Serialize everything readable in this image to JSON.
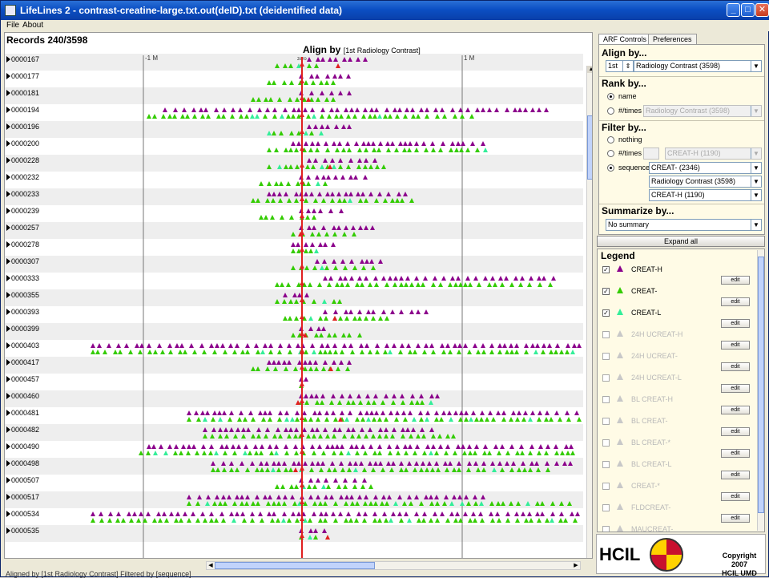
{
  "window": {
    "title": "LifeLines 2 - contrast-creatine-large.txt.out(deID).txt (deidentified data)",
    "buttons": {
      "minimize": "_",
      "maximize": "□",
      "close": "✕"
    }
  },
  "menu": {
    "file": "File",
    "about": "About"
  },
  "viz": {
    "records": "Records 240/3598",
    "align_title": "Align by",
    "align_detail": "[1st Radiology Contrast]",
    "axis_left_label": "-1 M",
    "axis_right_label": "1 M",
    "axis_zero_label": "zero",
    "row_ids": [
      "0000167",
      "0000177",
      "0000181",
      "0000194",
      "0000196",
      "0000200",
      "0000228",
      "0000232",
      "0000233",
      "0000239",
      "0000257",
      "0000278",
      "0000307",
      "0000333",
      "0000355",
      "0000393",
      "0000399",
      "0000403",
      "0000417",
      "0000457",
      "0000460",
      "0000481",
      "0000482",
      "0000490",
      "0000498",
      "0000507",
      "0000517",
      "0000534",
      "0000535"
    ]
  },
  "status": "Aligned by [1st Radiology Contrast]   Filtered by [sequence]",
  "controls": {
    "tabs": {
      "arf": "ARF Controls",
      "preferences": "Preferences"
    },
    "align_by": {
      "title": "Align by...",
      "ordinal": "1st",
      "event": "Radiology Contrast (3598)"
    },
    "rank_by": {
      "title": "Rank by...",
      "option_name": "name",
      "option_times": "#/times",
      "times_event": "Radiology Contrast (3598)"
    },
    "filter_by": {
      "title": "Filter by...",
      "option_nothing": "nothing",
      "option_times": "#/times",
      "option_sequence": "sequence",
      "times_event": "CREAT-H (1190)",
      "sequence": [
        "CREAT- (2346)",
        "Radiology Contrast (3598)",
        "CREAT-H (1190)"
      ]
    },
    "summarize_by": {
      "title": "Summarize by...",
      "value": "No summary"
    },
    "expand_all": "Expand all"
  },
  "legend": {
    "title": "Legend",
    "edit_label": "edit",
    "checked_mark": "✓",
    "items": [
      {
        "name": "CREAT-H",
        "color": "#8b008b",
        "checked": true
      },
      {
        "name": "CREAT-",
        "color": "#33cc00",
        "checked": true
      },
      {
        "name": "CREAT-L",
        "color": "#33ee99",
        "checked": true
      },
      {
        "name": "24H UCREAT-H",
        "color": "#c8c8c8",
        "checked": false
      },
      {
        "name": "24H UCREAT-",
        "color": "#c8c8c8",
        "checked": false
      },
      {
        "name": "24H UCREAT-L",
        "color": "#c8c8c8",
        "checked": false
      },
      {
        "name": "BL CREAT-H",
        "color": "#c8c8c8",
        "checked": false
      },
      {
        "name": "BL CREAT-",
        "color": "#c8c8c8",
        "checked": false
      },
      {
        "name": "BL CREAT-*",
        "color": "#c8c8c8",
        "checked": false
      },
      {
        "name": "BL CREAT-L",
        "color": "#c8c8c8",
        "checked": false
      },
      {
        "name": "CREAT-*",
        "color": "#c8c8c8",
        "checked": false
      },
      {
        "name": "FLDCREAT-",
        "color": "#c8c8c8",
        "checked": false
      },
      {
        "name": "MAUCREAT-",
        "color": "#c8c8c8",
        "checked": false
      }
    ]
  },
  "logo": {
    "text": "HCIL",
    "copyright_line1": "Copyright 2007",
    "copyright_line2": "HCIL  UMD"
  },
  "colors": {
    "creat_h": "#8b008b",
    "creat": "#33cc00",
    "creat_l": "#33ee99",
    "radiology_contrast": "#e02020"
  }
}
